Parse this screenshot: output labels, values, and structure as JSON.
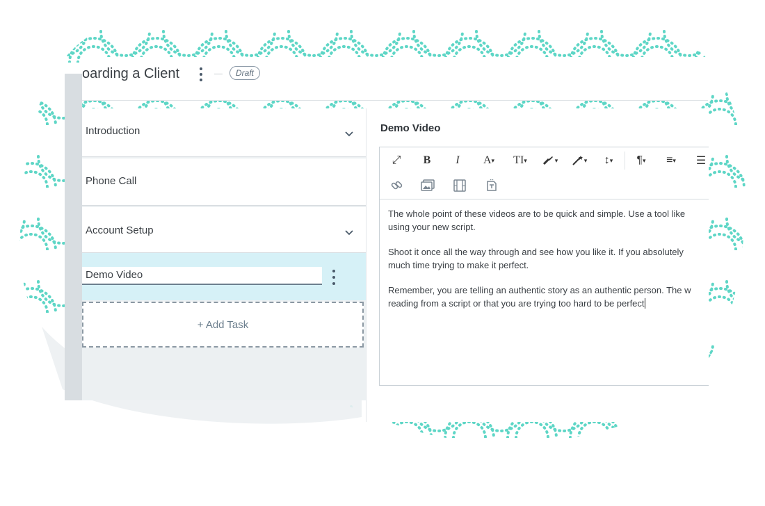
{
  "header": {
    "title": "oarding a Client",
    "status_badge": "Draft"
  },
  "tasks": [
    {
      "label": "Introduction",
      "expandable": true
    },
    {
      "label": "Phone Call",
      "expandable": false
    },
    {
      "label": "Account Setup",
      "expandable": true
    },
    {
      "label": "Demo Video",
      "editing": true
    }
  ],
  "add_task_label": "+ Add Task",
  "detail": {
    "title": "Demo Video",
    "toolbar_row1": [
      {
        "icon": "fullscreen-icon",
        "glyph": "⤢"
      },
      {
        "icon": "bold-icon",
        "glyph": "B"
      },
      {
        "icon": "italic-icon",
        "glyph": "I"
      },
      {
        "icon": "font-color-icon",
        "glyph": "A▾"
      },
      {
        "icon": "font-size-icon",
        "glyph": "TI▾"
      },
      {
        "icon": "paint-brush-icon",
        "glyph": "🖌▾"
      },
      {
        "icon": "magic-wand-icon",
        "glyph": "⚲▾"
      },
      {
        "icon": "line-height-icon",
        "glyph": "↕▾"
      },
      {
        "icon": "paragraph-icon",
        "glyph": "¶▾"
      },
      {
        "icon": "align-icon",
        "glyph": "≡▾"
      },
      {
        "icon": "list-icon",
        "glyph": "☰"
      }
    ],
    "toolbar_row2": [
      {
        "icon": "link-icon"
      },
      {
        "icon": "image-icon"
      },
      {
        "icon": "video-icon"
      },
      {
        "icon": "file-icon"
      }
    ],
    "paragraphs": [
      [
        "The whole point of these videos are to be quick and simple. Use a tool like",
        "using your new script."
      ],
      [
        "Shoot it once all the way through and see how you like it. If you absolutely",
        "much time trying to make it perfect."
      ],
      [
        "Remember, you are telling an authentic story as an authentic person. The w",
        "reading from a script or that you are trying too hard to be perfect"
      ]
    ]
  },
  "colors": {
    "accent_teal": "#5ed6c6",
    "active_task_bg": "#d6f1f7",
    "panel_bg": "#ecf0f2"
  }
}
